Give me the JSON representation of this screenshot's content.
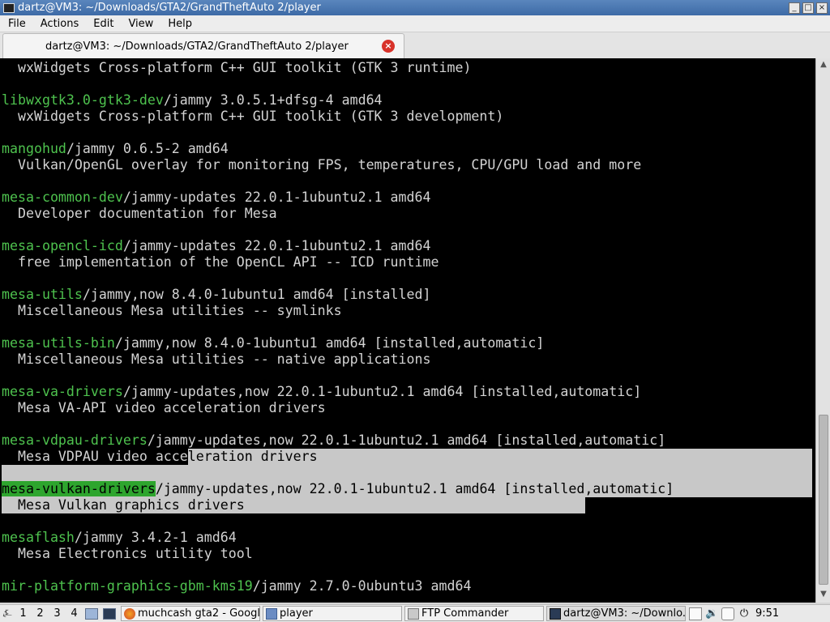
{
  "window": {
    "title": "dartz@VM3: ~/Downloads/GTA2/GrandTheftAuto 2/player"
  },
  "menu": [
    "File",
    "Actions",
    "Edit",
    "View",
    "Help"
  ],
  "tab": {
    "label": "dartz@VM3: ~/Downloads/GTA2/GrandTheftAuto 2/player"
  },
  "terminal": {
    "lines": [
      {
        "pkg": "",
        "rest": "  wxWidgets Cross-platform C++ GUI toolkit (GTK 3 runtime)"
      },
      {
        "pkg": "",
        "rest": ""
      },
      {
        "pkg": "libwxgtk3.0-gtk3-dev",
        "rest": "/jammy 3.0.5.1+dfsg-4 amd64"
      },
      {
        "pkg": "",
        "rest": "  wxWidgets Cross-platform C++ GUI toolkit (GTK 3 development)"
      },
      {
        "pkg": "",
        "rest": ""
      },
      {
        "pkg": "mangohud",
        "rest": "/jammy 0.6.5-2 amd64"
      },
      {
        "pkg": "",
        "rest": "  Vulkan/OpenGL overlay for monitoring FPS, temperatures, CPU/GPU load and more"
      },
      {
        "pkg": "",
        "rest": ""
      },
      {
        "pkg": "mesa-common-dev",
        "rest": "/jammy-updates 22.0.1-1ubuntu2.1 amd64"
      },
      {
        "pkg": "",
        "rest": "  Developer documentation for Mesa"
      },
      {
        "pkg": "",
        "rest": ""
      },
      {
        "pkg": "mesa-opencl-icd",
        "rest": "/jammy-updates 22.0.1-1ubuntu2.1 amd64"
      },
      {
        "pkg": "",
        "rest": "  free implementation of the OpenCL API -- ICD runtime"
      },
      {
        "pkg": "",
        "rest": ""
      },
      {
        "pkg": "mesa-utils",
        "rest": "/jammy,now 8.4.0-1ubuntu1 amd64 [installed]"
      },
      {
        "pkg": "",
        "rest": "  Miscellaneous Mesa utilities -- symlinks"
      },
      {
        "pkg": "",
        "rest": ""
      },
      {
        "pkg": "mesa-utils-bin",
        "rest": "/jammy,now 8.4.0-1ubuntu1 amd64 [installed,automatic]"
      },
      {
        "pkg": "",
        "rest": "  Miscellaneous Mesa utilities -- native applications"
      },
      {
        "pkg": "",
        "rest": ""
      },
      {
        "pkg": "mesa-va-drivers",
        "rest": "/jammy-updates,now 22.0.1-1ubuntu2.1 amd64 [installed,automatic]"
      },
      {
        "pkg": "",
        "rest": "  Mesa VA-API video acceleration drivers"
      },
      {
        "pkg": "",
        "rest": ""
      },
      {
        "pkg": "mesa-vdpau-drivers",
        "rest": "/jammy-updates,now 22.0.1-1ubuntu2.1 amd64 [installed,automatic]"
      },
      {
        "pkg": "",
        "rest": "  Mesa VDPAU video acceleration drivers"
      },
      {
        "pkg": "",
        "rest": ""
      },
      {
        "pkg": "mesa-vulkan-drivers",
        "rest": "/jammy-updates,now 22.0.1-1ubuntu2.1 amd64 [installed,automatic]"
      },
      {
        "pkg": "",
        "rest": "  Mesa Vulkan graphics drivers"
      },
      {
        "pkg": "",
        "rest": ""
      },
      {
        "pkg": "mesaflash",
        "rest": "/jammy 3.4.2-1 amd64"
      },
      {
        "pkg": "",
        "rest": "  Mesa Electronics utility tool"
      },
      {
        "pkg": "",
        "rest": ""
      },
      {
        "pkg": "mir-platform-graphics-gbm-kms19",
        "rest": "/jammy 2.7.0-0ubuntu3 amd64"
      }
    ]
  },
  "taskbar": {
    "workspaces": [
      "1",
      "2",
      "3",
      "4"
    ],
    "tasks": [
      {
        "label": "muchcash gta2 - Googl...",
        "icon": "firefox-icon"
      },
      {
        "label": "player",
        "icon": "folder-icon"
      },
      {
        "label": "FTP Commander",
        "icon": "ftp-icon"
      },
      {
        "label": "dartz@VM3: ~/Downlo...",
        "icon": "terminal-icon"
      }
    ],
    "clock": "9:51"
  },
  "colors": {
    "package": "#4ec24e",
    "terminal_bg": "#000000",
    "selection": "#c8c8c8",
    "titlebar": "#4a78b3"
  }
}
